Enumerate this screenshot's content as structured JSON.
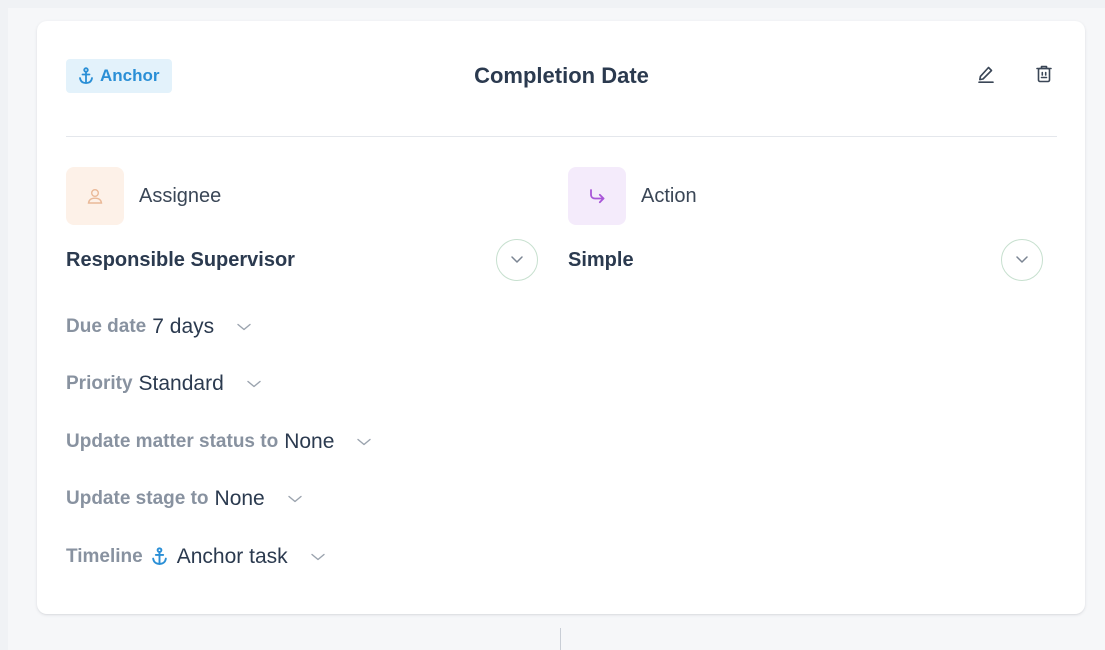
{
  "card": {
    "badge": {
      "label": "Anchor",
      "icon": "anchor-icon",
      "color": "#2a8fd6",
      "background": "#e3f2fb"
    },
    "title": "Completion Date",
    "actions": [
      {
        "name": "edit",
        "icon": "pencil-icon"
      },
      {
        "name": "delete",
        "icon": "trash-icon"
      }
    ]
  },
  "assignee": {
    "label": "Assignee",
    "icon": "user-icon",
    "value": "Responsible Supervisor"
  },
  "action": {
    "label": "Action",
    "icon": "redirect-arrow-icon",
    "value": "Simple"
  },
  "fields": {
    "due_date": {
      "label": "Due date",
      "value": "7 days"
    },
    "priority": {
      "label": "Priority",
      "value": "Standard"
    },
    "matter_status": {
      "label": "Update matter status to",
      "value": "None"
    },
    "stage": {
      "label": "Update stage to",
      "value": "None"
    },
    "timeline": {
      "label": "Timeline",
      "value": "Anchor task",
      "icon": "anchor-icon"
    }
  },
  "colors": {
    "accent_blue": "#2a8fd6",
    "action_purple": "#a855d8",
    "assignee_orange": "#f2c6a4",
    "text_dark": "#2b3a4f",
    "text_muted": "#8892a0"
  }
}
